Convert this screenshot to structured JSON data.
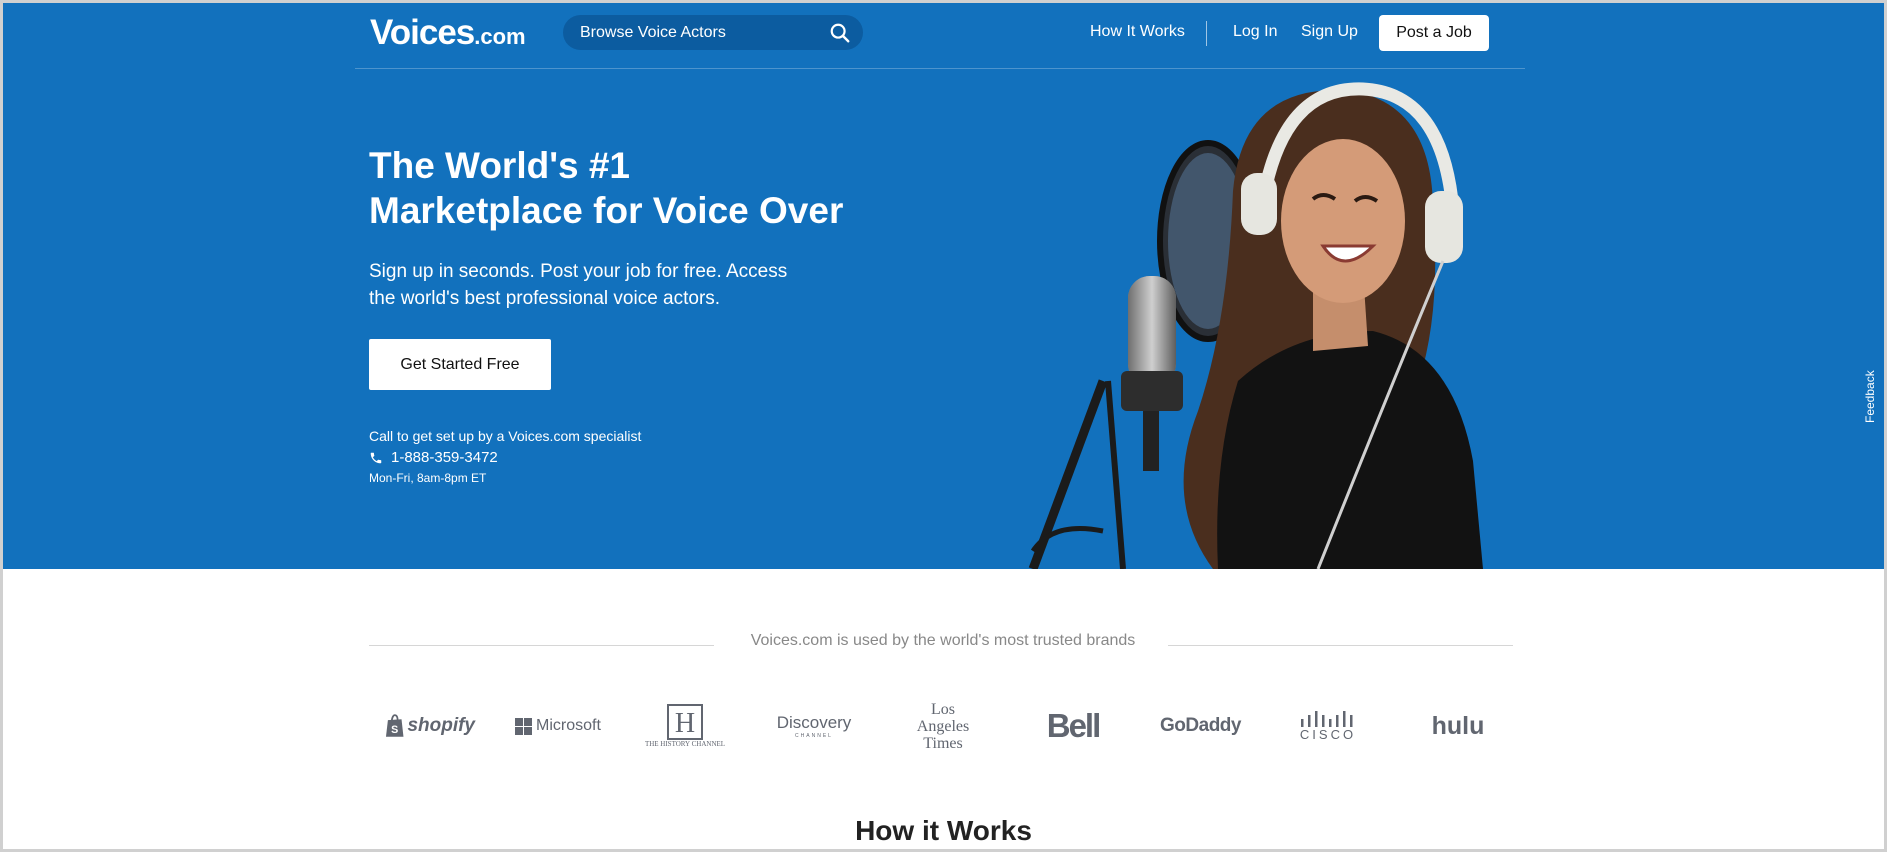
{
  "header": {
    "logo_main": "Voices",
    "logo_tld": ".com",
    "search_placeholder": "Browse Voice Actors",
    "nav": {
      "how_it_works": "How It Works",
      "log_in": "Log In",
      "sign_up": "Sign Up",
      "post_job": "Post a Job"
    }
  },
  "hero": {
    "headline": "The World's #1 Marketplace for Voice Over",
    "subhead": "Sign up in seconds. Post your job for free. Access the world's best professional voice actors.",
    "cta": "Get Started Free",
    "call_text": "Call to get set up by a Voices.com specialist",
    "phone": "1-888-359-3472",
    "hours": "Mon-Fri, 8am-8pm ET"
  },
  "feedback": "Feedback",
  "brands": {
    "caption": "Voices.com is used by the world's most trusted brands",
    "logos": {
      "shopify": "shopify",
      "microsoft": "Microsoft",
      "history": "THE HISTORY CHANNEL",
      "discovery": "Discovery",
      "discovery_sub": "CHANNEL",
      "latimes_1": "Los",
      "latimes_2": "Angeles",
      "latimes_3": "Times",
      "bell": "Bell",
      "godaddy": "GoDaddy",
      "cisco": "CISCO",
      "hulu": "hulu"
    }
  },
  "how_it_works_title": "How it Works",
  "colors": {
    "hero_bg": "#1271bd",
    "search_bg": "#0c5ca0",
    "brand_grey": "#616670"
  }
}
